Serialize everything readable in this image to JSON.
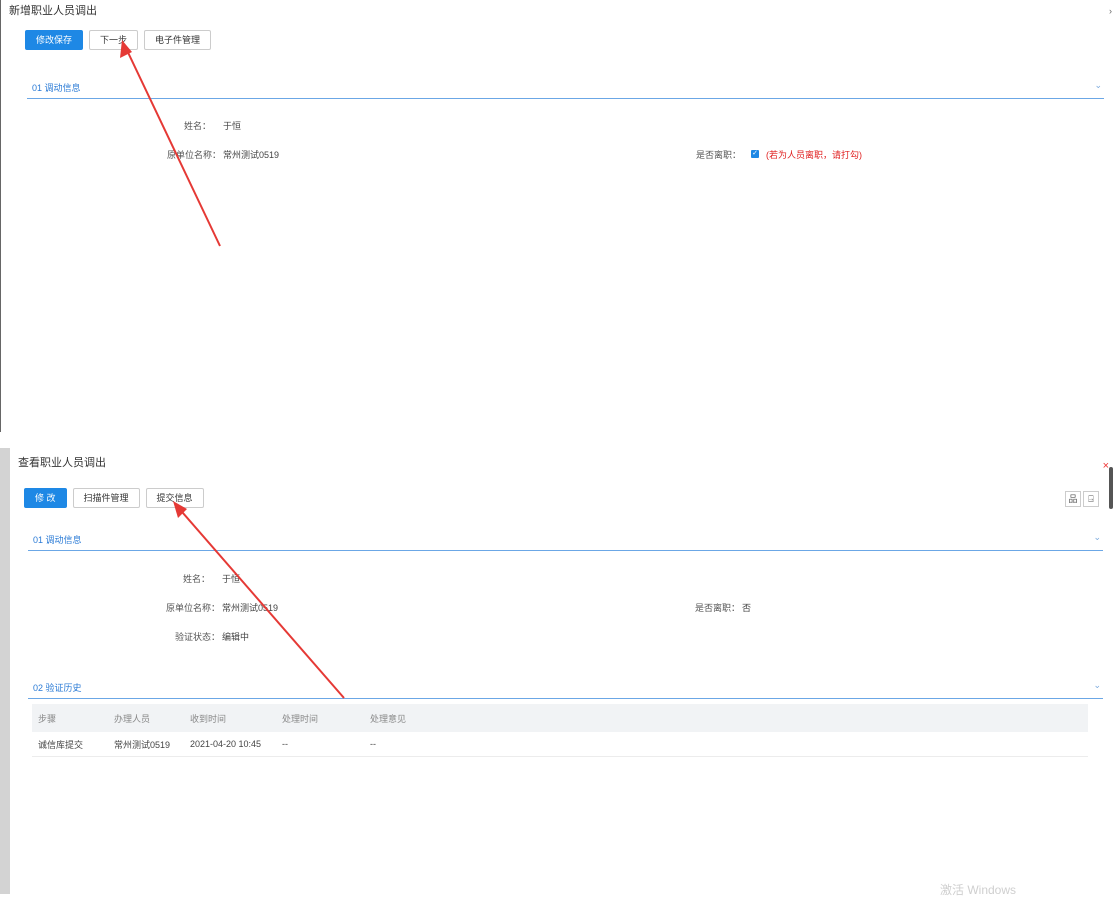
{
  "top_panel": {
    "title": "新增职业人员调出",
    "corner_mark": "›",
    "toolbar": {
      "save_label": "修改保存",
      "next_label": "下一步",
      "efile_label": "电子件管理"
    },
    "section1": {
      "title": "01 调动信息",
      "chevron": "⌄"
    },
    "fields": {
      "name_label": "姓名：",
      "name_value": "于恒",
      "org_label": "原单位名称：",
      "org_value": "常州测试0519",
      "left_label": "是否离职：",
      "left_check": "✓",
      "left_note": "(若为人员离职，请打勾)"
    }
  },
  "bottom_panel": {
    "title": "查看职业人员调出",
    "close": "×",
    "toolbar": {
      "edit_label": "修 改",
      "scan_label": "扫描件管理",
      "submit_label": "提交信息"
    },
    "icons": {
      "org_icon": "品",
      "pdf_icon": "⍈"
    },
    "section1": {
      "title": "01 调动信息",
      "chevron": "⌄"
    },
    "fields": {
      "name_label": "姓名：",
      "name_value": "于恒",
      "org_label": "原单位名称：",
      "org_value": "常州测试0519",
      "left_label": "是否离职：",
      "left_value": "否",
      "verify_label": "验证状态：",
      "verify_value": "编辑中"
    },
    "section2": {
      "title": "02 验证历史",
      "chevron": "⌄"
    },
    "table": {
      "columns": [
        "步骤",
        "办理人员",
        "收到时间",
        "处理时间",
        "处理意见"
      ],
      "rows": [
        [
          "诚信库提交",
          "常州测试0519",
          "2021-04-20 10:45",
          "--",
          "--"
        ]
      ]
    },
    "watermark": "激活 Windows"
  },
  "colors": {
    "accent": "#1e88e5",
    "arrow": "#e53935",
    "note": "#e02020"
  }
}
